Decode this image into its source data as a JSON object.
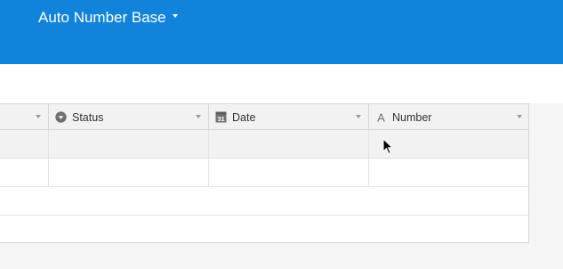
{
  "header": {
    "base_name": "Auto Number Base",
    "background_color": "#1283da"
  },
  "grid": {
    "columns": [
      {
        "label": "",
        "icon": "none"
      },
      {
        "label": "Status",
        "icon": "single-select-icon"
      },
      {
        "label": "Date",
        "icon": "calendar-icon"
      },
      {
        "label": "Number",
        "icon": "text-field-icon"
      }
    ],
    "calendar_icon_day": "31",
    "text_icon_glyph": "A",
    "rows": [
      [
        "",
        "",
        "",
        ""
      ],
      [
        "",
        "",
        "",
        ""
      ],
      [
        "",
        "",
        "",
        ""
      ]
    ]
  }
}
